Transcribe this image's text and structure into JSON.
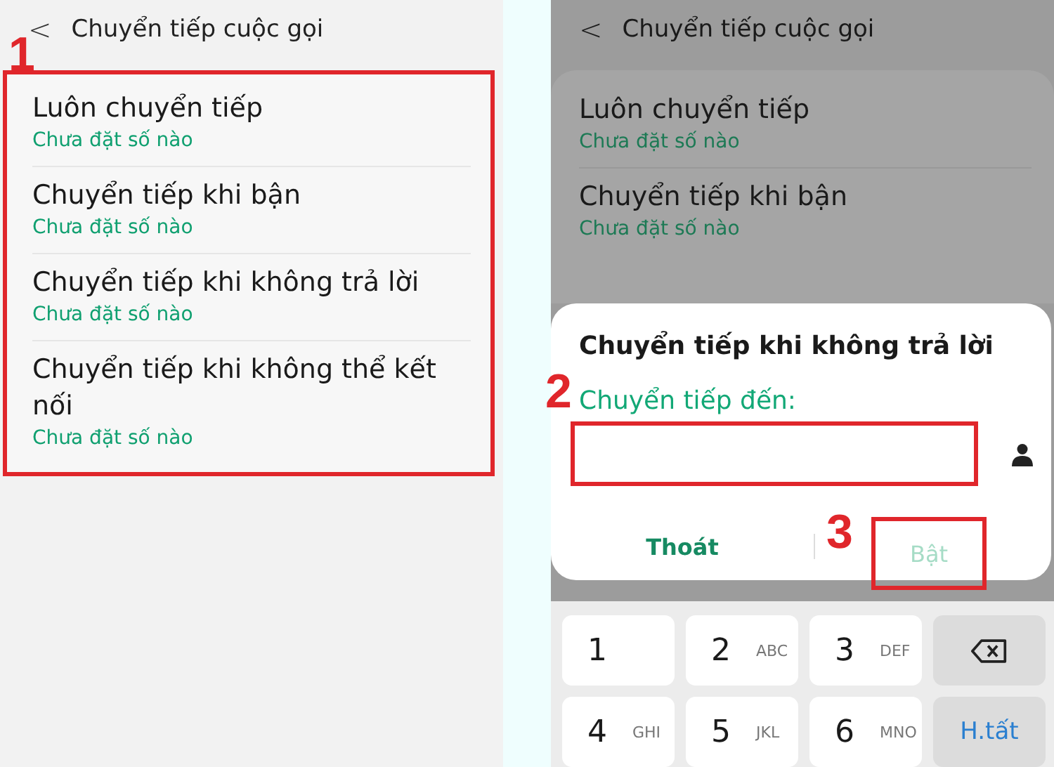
{
  "left_screen": {
    "header": {
      "back": "<",
      "title": "Chuyển tiếp cuộc gọi"
    },
    "callout": "1",
    "highlighted": true,
    "items": [
      {
        "title": "Luôn chuyển tiếp",
        "subtitle": "Chưa đặt số nào"
      },
      {
        "title": "Chuyển tiếp khi bận",
        "subtitle": "Chưa đặt số nào"
      },
      {
        "title": "Chuyển tiếp khi không trả lời",
        "subtitle": "Chưa đặt số nào"
      },
      {
        "title": "Chuyển tiếp khi không thể kết nối",
        "subtitle": "Chưa đặt số nào"
      }
    ]
  },
  "right_screen": {
    "header": {
      "back": "<",
      "title": "Chuyển tiếp cuộc gọi"
    },
    "items": [
      {
        "title": "Luôn chuyển tiếp",
        "subtitle": "Chưa đặt số nào"
      },
      {
        "title": "Chuyển tiếp khi bận",
        "subtitle": "Chưa đặt số nào"
      }
    ],
    "dialog": {
      "title": "Chuyển tiếp khi không trả lời",
      "field_label": "Chuyển tiếp đến:",
      "field": {
        "callout": "2",
        "highlighted": true
      },
      "buttons": [
        {
          "label": "Thoát",
          "disabled": false,
          "highlighted": false
        },
        {
          "label": "Bật",
          "disabled": true,
          "highlighted": true,
          "callout": "3"
        }
      ]
    },
    "keypad": [
      {
        "kind": "digit",
        "label": "1"
      },
      {
        "kind": "digit",
        "label": "2",
        "letters": "ABC"
      },
      {
        "kind": "digit",
        "label": "3",
        "letters": "DEF"
      },
      {
        "kind": "backspace"
      },
      {
        "kind": "digit",
        "label": "4",
        "letters": "GHI"
      },
      {
        "kind": "digit",
        "label": "5",
        "letters": "JKL"
      },
      {
        "kind": "digit",
        "label": "6",
        "letters": "MNO"
      },
      {
        "kind": "action",
        "label": "H.tất"
      }
    ]
  }
}
